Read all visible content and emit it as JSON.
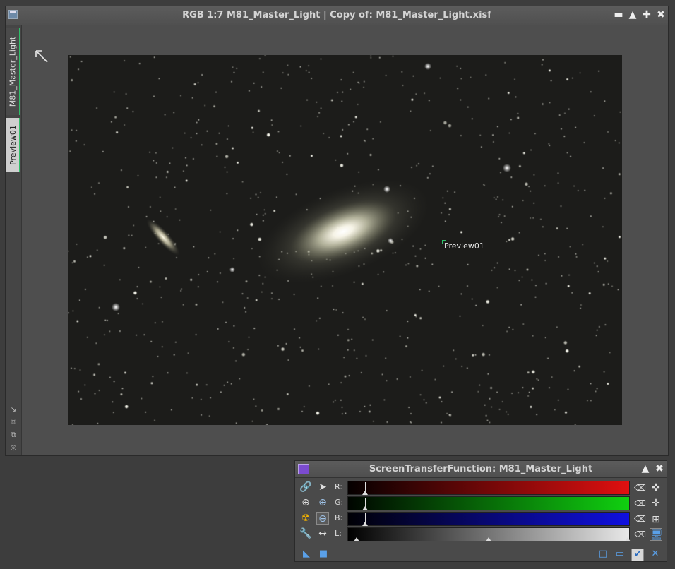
{
  "image_window": {
    "title": "RGB 1:7 M81_Master_Light | Copy of: M81_Master_Light.xisf",
    "tabs": [
      {
        "label": "M81_Master_Light"
      },
      {
        "label": "Preview01"
      }
    ],
    "preview_label": "Preview01",
    "title_buttons": {
      "shade": "▬",
      "minimize": "▲",
      "maximize": "✚",
      "close": "✖"
    }
  },
  "stf_panel": {
    "title": "ScreenTransferFunction: M81_Master_Light",
    "channels": [
      {
        "label": "R:",
        "shadows": 0.03,
        "midtones": 0.03,
        "highlights": 1.0,
        "color": "#e01010"
      },
      {
        "label": "G:",
        "shadows": 0.03,
        "midtones": 0.03,
        "highlights": 1.0,
        "color": "#10d010"
      },
      {
        "label": "B:",
        "shadows": 0.03,
        "midtones": 0.03,
        "highlights": 1.0,
        "color": "#1010e0"
      },
      {
        "label": "L:",
        "shadows": 0.0,
        "midtones": 0.5,
        "highlights": 1.0,
        "color": "#e8e8e8"
      }
    ],
    "accent_color": "#5aa0e8"
  }
}
